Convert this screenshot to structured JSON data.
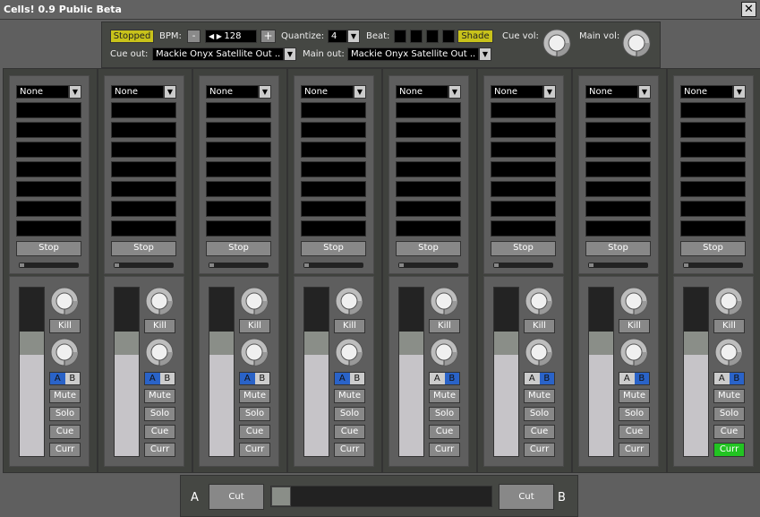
{
  "window": {
    "title": "Cells! 0.9 Public Beta",
    "close_icon": "close-icon"
  },
  "transport": {
    "status": "Stopped",
    "bpm_label": "BPM:",
    "bpm_minus": "-",
    "bpm_value": "128",
    "bpm_plus": "+",
    "quantize_label": "Quantize:",
    "quantize_value": "4",
    "beat_label": "Beat:",
    "beat_count": 4,
    "shade": "Shade",
    "cue_vol_label": "Cue vol:",
    "main_vol_label": "Main vol:",
    "cue_out_label": "Cue out:",
    "cue_out_value": "Mackie Onyx Satellite Out ..",
    "main_out_label": "Main out:",
    "main_out_value": "Mackie Onyx Satellite Out ..",
    "active_color": "#c8c21a"
  },
  "channel_labels": {
    "dropdown": "None",
    "stop": "Stop",
    "kill": "Kill",
    "a": "A",
    "b": "B",
    "mute": "Mute",
    "solo": "Solo",
    "cue": "Cue",
    "curr": "Curr"
  },
  "channels": [
    {
      "assign": "A",
      "curr_active": false
    },
    {
      "assign": "A",
      "curr_active": false
    },
    {
      "assign": "A",
      "curr_active": false
    },
    {
      "assign": "A",
      "curr_active": false
    },
    {
      "assign": "B",
      "curr_active": false
    },
    {
      "assign": "B",
      "curr_active": false
    },
    {
      "assign": "B",
      "curr_active": false
    },
    {
      "assign": "B",
      "curr_active": true
    }
  ],
  "clip_slots_per_channel": 7,
  "colors": {
    "assign": "#2a63c8",
    "curr_active": "#22c422"
  },
  "crossfader": {
    "a_label": "A",
    "b_label": "B",
    "cut_a": "Cut",
    "cut_b": "Cut",
    "position": 0
  }
}
